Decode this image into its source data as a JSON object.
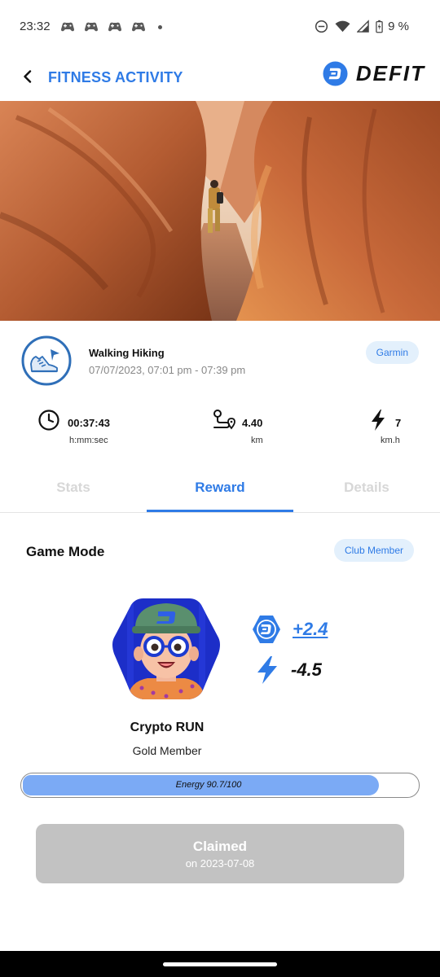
{
  "status_bar": {
    "time": "23:32",
    "battery_text": "9 %",
    "notification_icons": [
      "game-controller-icon",
      "game-controller-icon",
      "game-controller-icon",
      "game-controller-icon"
    ]
  },
  "header": {
    "title": "FITNESS ACTIVITY",
    "brand": "DEFIT",
    "accent_color": "#2f7be6"
  },
  "activity": {
    "name": "Walking Hiking",
    "datetime": "07/07/2023, 07:01 pm - 07:39 pm",
    "source": "Garmin",
    "icon": "walking-shoe-icon"
  },
  "metrics": {
    "duration": {
      "value": "00:37:43",
      "unit": "h:mm:sec",
      "icon": "clock-icon"
    },
    "distance": {
      "value": "4.40",
      "unit": "km",
      "icon": "route-icon"
    },
    "speed": {
      "value": "7",
      "unit": "km.h",
      "icon": "bolt-icon"
    }
  },
  "tabs": [
    {
      "label": "Stats",
      "active": false
    },
    {
      "label": "Reward",
      "active": true
    },
    {
      "label": "Details",
      "active": false
    }
  ],
  "game": {
    "title": "Game Mode",
    "badge": "Club Member",
    "reward_gain": "+2.4",
    "energy_cost": "-4.5",
    "character_name": "Crypto RUN",
    "character_tier": "Gold Member",
    "energy": {
      "label": "Energy 90.7/100",
      "current": 90.7,
      "max": 100,
      "fill_color": "#7baaf5"
    }
  },
  "claim": {
    "label": "Claimed",
    "date": "on 2023-07-08"
  }
}
